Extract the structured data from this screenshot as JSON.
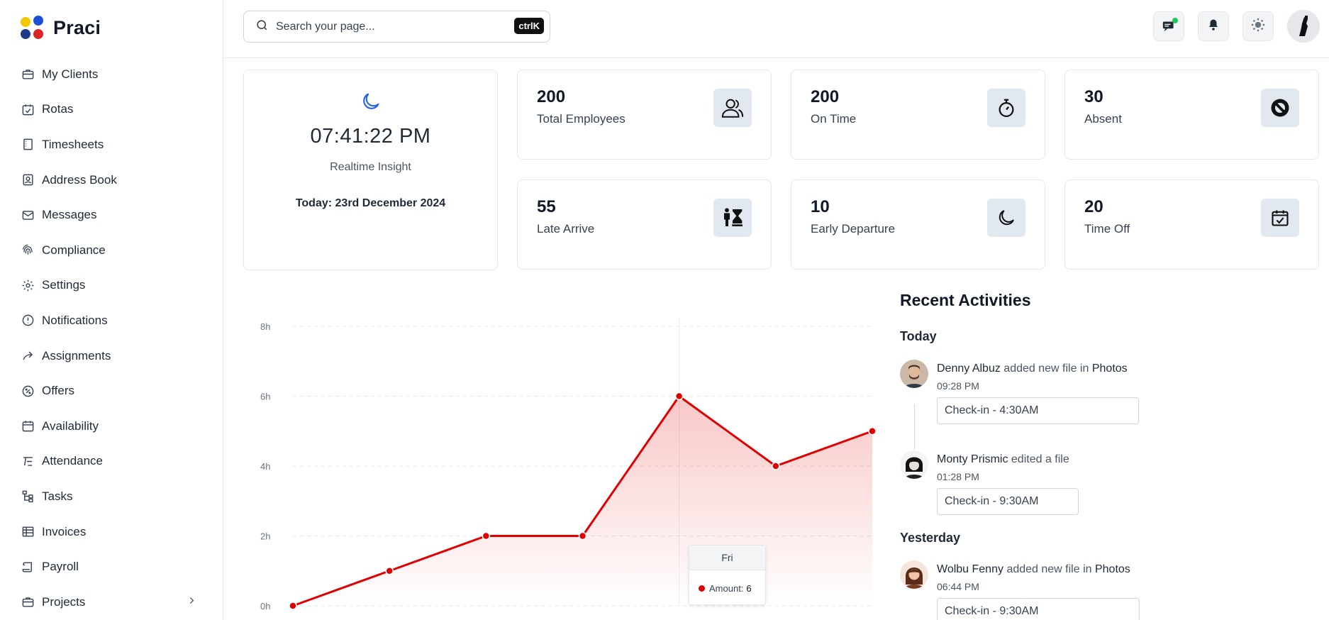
{
  "app": {
    "name": "Praci"
  },
  "sidebar": {
    "items": [
      {
        "label": "My Clients",
        "icon": "briefcase-icon"
      },
      {
        "label": "Rotas",
        "icon": "calendar-check-icon"
      },
      {
        "label": "Timesheets",
        "icon": "document-icon"
      },
      {
        "label": "Address Book",
        "icon": "contact-book-icon"
      },
      {
        "label": "Messages",
        "icon": "mail-icon"
      },
      {
        "label": "Compliance",
        "icon": "fingerprint-icon"
      },
      {
        "label": "Settings",
        "icon": "gear-icon"
      },
      {
        "label": "Notifications",
        "icon": "alert-circle-icon"
      },
      {
        "label": "Assignments",
        "icon": "forward-arrow-icon"
      },
      {
        "label": "Offers",
        "icon": "discount-badge-icon"
      },
      {
        "label": "Availability",
        "icon": "calendar-icon"
      },
      {
        "label": "Attendance",
        "icon": "attendance-icon"
      },
      {
        "label": "Tasks",
        "icon": "hierarchy-icon"
      },
      {
        "label": "Invoices",
        "icon": "invoice-icon"
      },
      {
        "label": "Payroll",
        "icon": "scroll-icon"
      },
      {
        "label": "Projects",
        "icon": "briefcase-icon"
      }
    ]
  },
  "header": {
    "search_placeholder": "Search your page...",
    "shortcut": "ctrlK"
  },
  "clock": {
    "time": "07:41:22 PM",
    "subtitle": "Realtime Insight",
    "date": "Today: 23rd December 2024"
  },
  "stats": [
    {
      "value": "200",
      "label": "Total Employees",
      "icon": "users-icon"
    },
    {
      "value": "200",
      "label": "On Time",
      "icon": "stopwatch-icon"
    },
    {
      "value": "30",
      "label": "Absent",
      "icon": "block-icon"
    },
    {
      "value": "55",
      "label": "Late Arrive",
      "icon": "hourglass-person-icon"
    },
    {
      "value": "10",
      "label": "Early Departure",
      "icon": "moon-icon"
    },
    {
      "value": "20",
      "label": "Time Off",
      "icon": "calendar-check-icon"
    }
  ],
  "activities": {
    "title": "Recent Activities",
    "groups": [
      {
        "day": "Today",
        "items": [
          {
            "name": "Denny Albuz",
            "action": "added new file in",
            "target": "Photos",
            "time": "09:28 PM",
            "chip": "Check-in - 4:30AM"
          },
          {
            "name": "Monty Prismic",
            "action": "edited a file",
            "target": "",
            "time": "01:28 PM",
            "chip": "Check-in - 9:30AM"
          }
        ]
      },
      {
        "day": "Yesterday",
        "items": [
          {
            "name": "Wolbu Fenny",
            "action": "added new file in",
            "target": "Photos",
            "time": "06:44 PM",
            "chip": "Check-in - 9:30AM"
          }
        ]
      }
    ]
  },
  "chart_data": {
    "type": "area",
    "yticks": [
      "0h",
      "2h",
      "4h",
      "6h",
      "8h"
    ],
    "ylim": [
      0,
      8
    ],
    "values": [
      0,
      1,
      2,
      2,
      6,
      4,
      5
    ],
    "tooltip": {
      "category": "Fri",
      "label": "Amount:",
      "value": "6"
    },
    "color": "#e00000"
  }
}
